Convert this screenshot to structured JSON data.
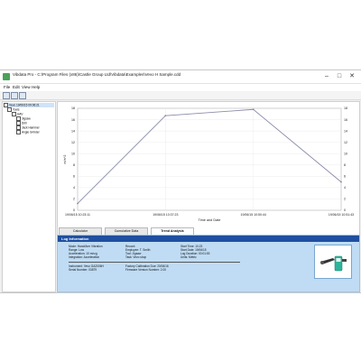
{
  "window": {
    "title": "Vibdata Pro - C:\\Program Files (x86)\\Castle Group Ltd\\Vibdata\\Examples\\Vevo H Sample.cdd",
    "min_glyph": "–",
    "max_glyph": "□",
    "close_glyph": "✕"
  },
  "menu": [
    "File",
    "Edit",
    "View",
    "Help"
  ],
  "tree": {
    "root": "Vevo 19/06/15 09:06:21",
    "group": "Tools",
    "subgroup": "HAV",
    "items": [
      "Jigsaw",
      "Drill",
      "Jack Hammer",
      "Angle Grinder"
    ]
  },
  "chart_data": {
    "type": "line",
    "x": [
      "19/06/15 10:23:11",
      "19/06/15 10:37:23",
      "19/06/15 10:50:44",
      "19/06/15 10:51:43"
    ],
    "values": [
      1.2,
      16.7,
      17.8,
      5.0
    ],
    "xlabel": "Time and Date",
    "ylabel": "m/s^2",
    "ylim": [
      0,
      18
    ],
    "y_ticks": [
      "0",
      "2",
      "4",
      "6",
      "8",
      "10",
      "12",
      "14",
      "16",
      "18"
    ],
    "grid": true,
    "line_color": "#8c8caa"
  },
  "tabs": [
    "Calculator",
    "Cumulative Data",
    "Trend Analysis"
  ],
  "active_tab": 2,
  "log": {
    "title": "Log Information",
    "col1": [
      "Mode: Hand/Arm Vibration",
      "Range: Low",
      "Acceleration: 10 m/s²g",
      "Integration: Acceleration"
    ],
    "col2": [
      "Record:",
      "Employee: T. Smith",
      "Tool: Jigsaw",
      "Task: Vevo shop"
    ],
    "col3": [
      "Start Time: 10:23",
      "Start Date: 19/06/15",
      "Log Duration: 00:01:53",
      "Units: Metric"
    ],
    "instrument": [
      "Instrument: Vevo GA2006H",
      "Serial Number: 03879"
    ],
    "calibration": [
      "Factory Calibration Due: 20/06/16",
      "Firmware Version Number: 2.00"
    ]
  },
  "colors": {
    "log_header": "#1e4fa0",
    "log_background": "#bfdcf4",
    "device_accent": "#2fb49a"
  }
}
